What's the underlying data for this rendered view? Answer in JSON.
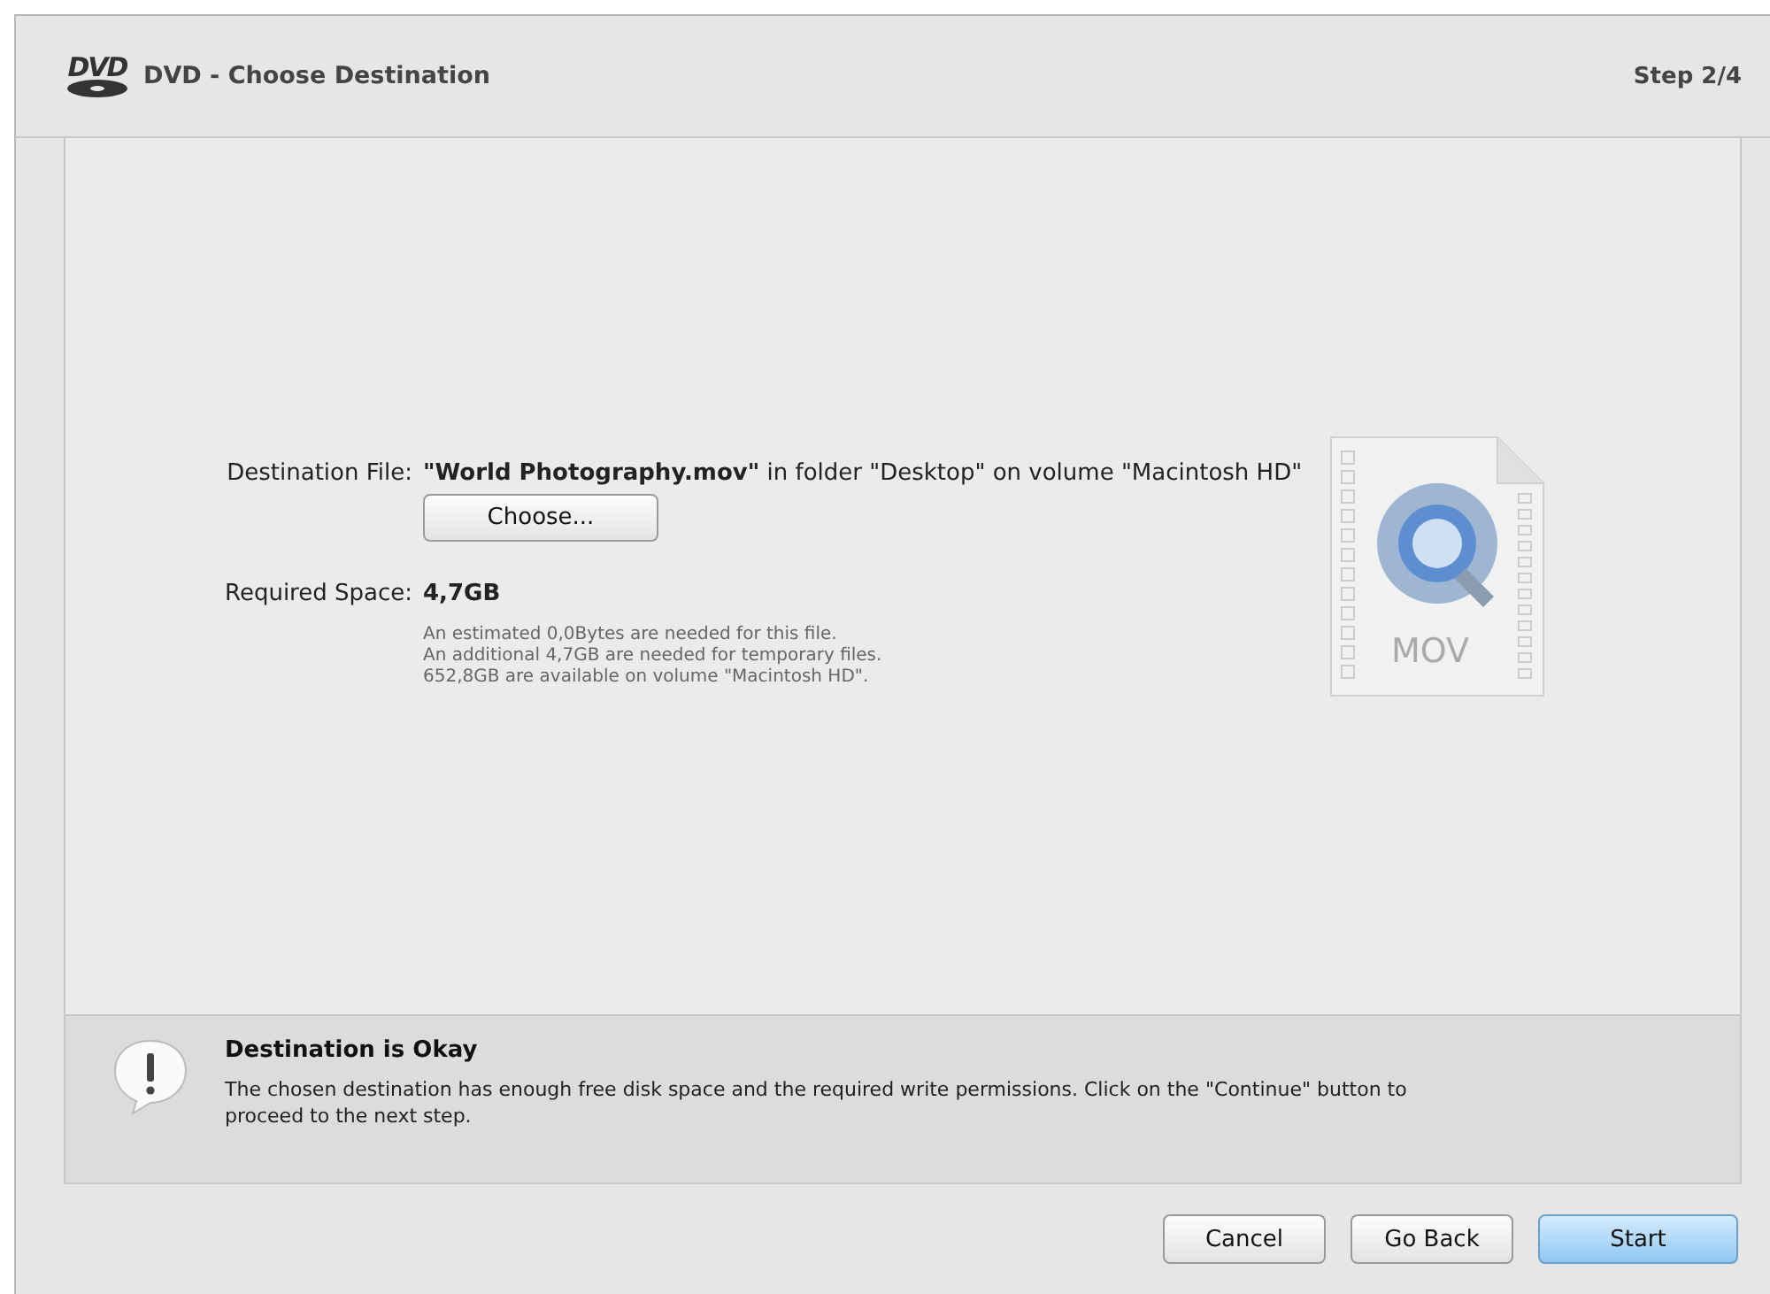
{
  "window": {
    "logo_text": "DVD",
    "title": "DVD - Choose Destination",
    "step": "Step 2/4"
  },
  "destination": {
    "label": "Destination File:",
    "value": "**\"World Photography.mov\"** in folder \"Desktop\" on volume \"Macintosh HD\"",
    "choose_button": "Choose..."
  },
  "file_icon": {
    "label": "MOV"
  },
  "required_space": {
    "label": "Required Space:",
    "value": "4,7GB",
    "notes": [
      "An estimated 0,0Bytes are needed for this file.",
      "An additional 4,7GB are needed for temporary files.",
      "652,8GB are available on volume \"Macintosh HD\"."
    ]
  },
  "status": {
    "title": "Destination is Okay",
    "message": "The chosen destination has enough free disk space and the required write permissions. Click on the \"Continue\" button to proceed to the next step."
  },
  "buttons": [
    {
      "label": "Cancel",
      "kind": "normal"
    },
    {
      "label": "Go Back",
      "kind": "normal"
    },
    {
      "label": "Start",
      "kind": "default"
    }
  ]
}
